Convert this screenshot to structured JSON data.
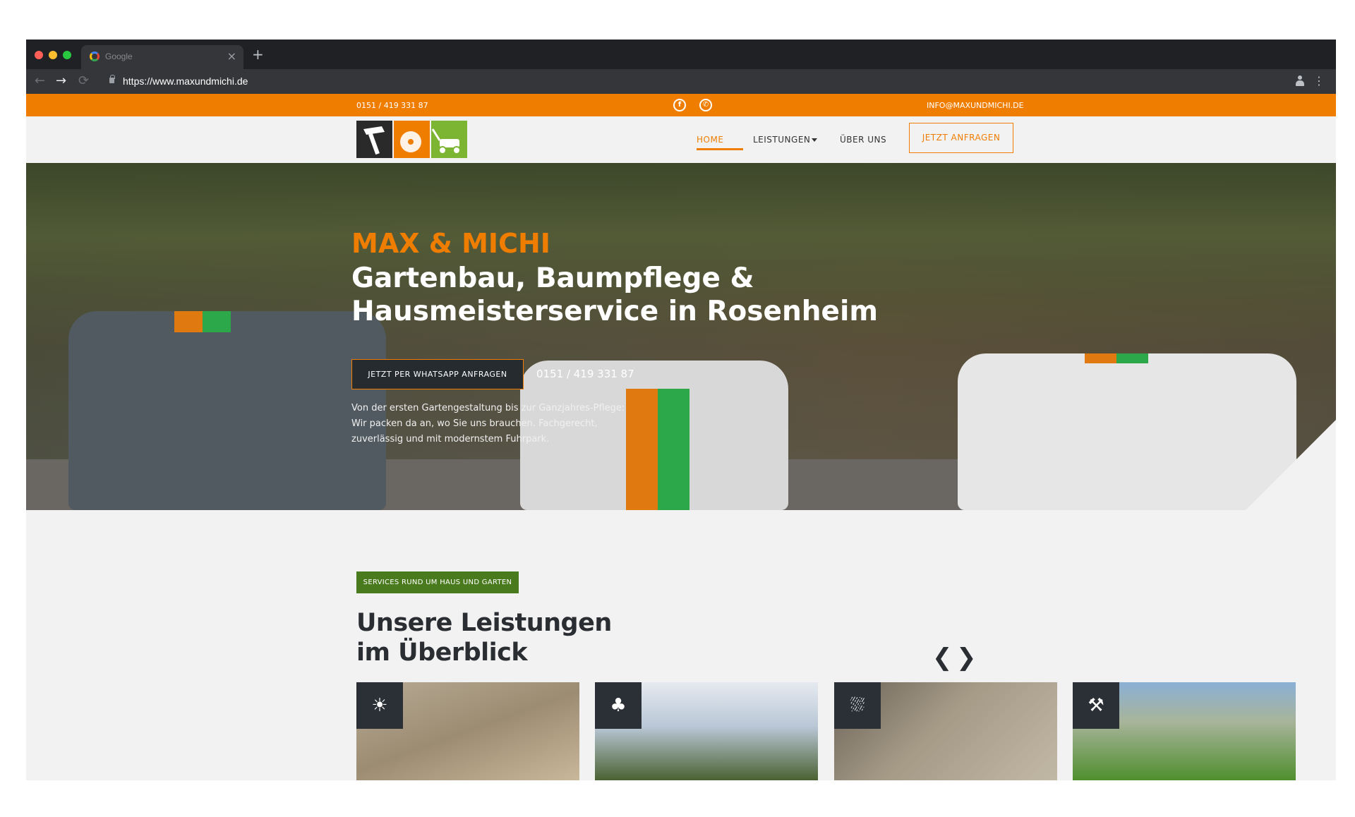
{
  "browser": {
    "tab_title": "Google",
    "tab_close": "×",
    "new_tab": "+",
    "url": "https://www.maxundmichi.de",
    "back_icon": "arrow-left-icon",
    "forward_icon": "arrow-right-icon",
    "reload_icon": "reload-icon",
    "menu_icon": "⋮"
  },
  "topbar": {
    "phone": "0151 / 419 331 87",
    "email": "INFO@MAXUNDMICHI.DE",
    "social_icons": [
      "facebook-icon",
      "whatsapp-icon"
    ],
    "color": "#ef7d00"
  },
  "nav": {
    "home": "HOME",
    "leistungen": "LEISTUNGEN",
    "ueber_uns": "ÜBER UNS",
    "cta": "JETZT ANFRAGEN"
  },
  "hero": {
    "title_orange": "MAX & MICHI",
    "title_line1": "Gartenbau, Baumpflege &",
    "title_line2": "Hausmeisterservice in Rosenheim",
    "whatsapp_button": "JETZT PER WHATSAPP ANFRAGEN",
    "phone": "0151 / 419 331 87",
    "text": "Von der ersten Gartengestaltung bis zur Ganzjahres-Pflege: Wir packen da an, wo Sie uns brauchen. Fachgerecht, zuverlässig und mit modernstem Fuhrpark."
  },
  "services": {
    "badge": "SERVICES RUND UM HAUS UND GARTEN",
    "title_line1": "Unsere Leistungen",
    "title_line2": "im Überblick",
    "prev_arrow": "❮",
    "next_arrow": "❯",
    "cards": [
      {
        "icon": "sun-icon"
      },
      {
        "icon": "tree-icon"
      },
      {
        "icon": "shower-icon"
      },
      {
        "icon": "worker-icon"
      }
    ]
  },
  "colors": {
    "accent": "#ef7d00",
    "green": "#7cb531",
    "badge_green": "#4a7a1e",
    "dark": "#2a2e33"
  }
}
